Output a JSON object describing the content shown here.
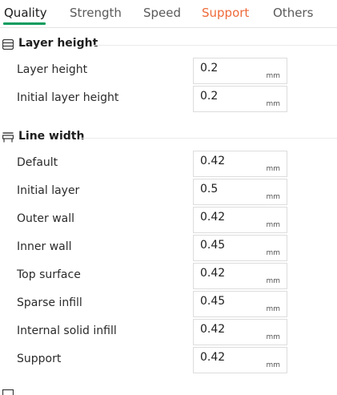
{
  "tabs": {
    "quality": "Quality",
    "strength": "Strength",
    "speed": "Speed",
    "support": "Support",
    "others": "Others"
  },
  "sections": {
    "layer_height": {
      "title": "Layer height",
      "icon": "layer-height-icon",
      "rows": [
        {
          "label": "Layer height",
          "value": "0.2",
          "unit": "mm"
        },
        {
          "label": "Initial layer height",
          "value": "0.2",
          "unit": "mm"
        }
      ]
    },
    "line_width": {
      "title": "Line width",
      "icon": "line-width-icon",
      "rows": [
        {
          "label": "Default",
          "value": "0.42",
          "unit": "mm"
        },
        {
          "label": "Initial layer",
          "value": "0.5",
          "unit": "mm"
        },
        {
          "label": "Outer wall",
          "value": "0.42",
          "unit": "mm"
        },
        {
          "label": "Inner wall",
          "value": "0.45",
          "unit": "mm"
        },
        {
          "label": "Top surface",
          "value": "0.42",
          "unit": "mm"
        },
        {
          "label": "Sparse infill",
          "value": "0.45",
          "unit": "mm"
        },
        {
          "label": "Internal solid infill",
          "value": "0.42",
          "unit": "mm"
        },
        {
          "label": "Support",
          "value": "0.42",
          "unit": "mm"
        }
      ]
    }
  },
  "colors": {
    "active_tab_underline": "#0b9c5e",
    "support_tab": "#ee6a3a"
  }
}
